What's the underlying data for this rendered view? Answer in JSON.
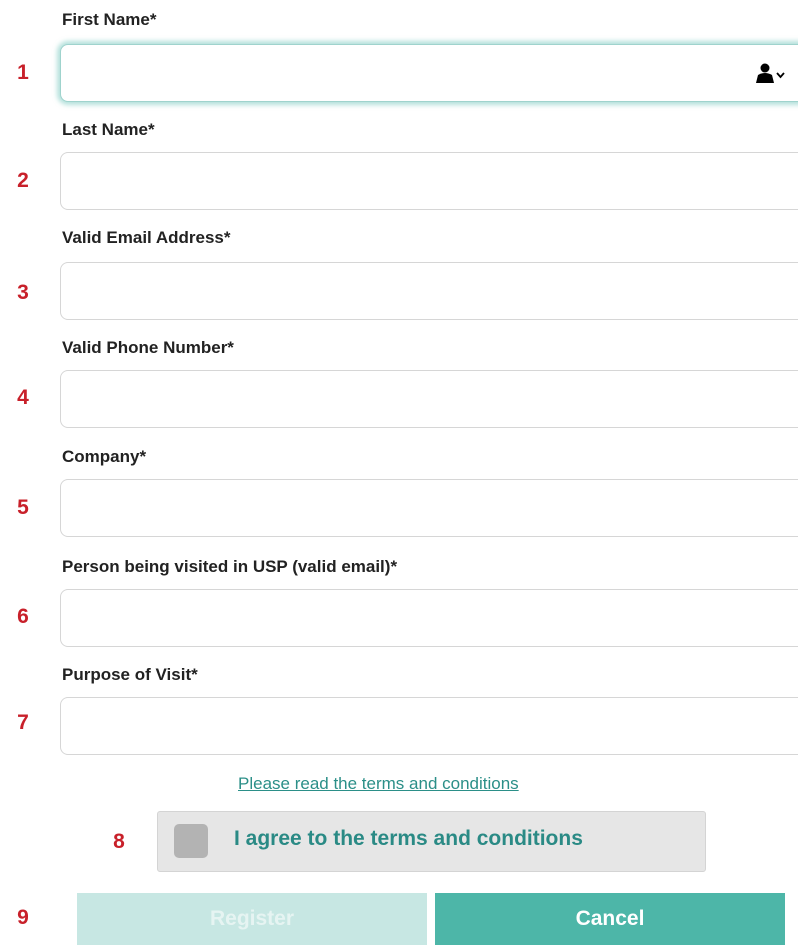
{
  "form": {
    "fields": [
      {
        "num": "1",
        "label": "First Name*",
        "value": ""
      },
      {
        "num": "2",
        "label": "Last Name*",
        "value": ""
      },
      {
        "num": "3",
        "label": "Valid Email Address*",
        "value": ""
      },
      {
        "num": "4",
        "label": "Valid Phone Number*",
        "value": ""
      },
      {
        "num": "5",
        "label": "Company*",
        "value": ""
      },
      {
        "num": "6",
        "label": "Person being visited in USP (valid email)*",
        "value": ""
      },
      {
        "num": "7",
        "label": "Purpose of Visit*",
        "value": ""
      }
    ],
    "autofill_icon": "person-autofill-icon",
    "terms_link": "Please read the terms and conditions",
    "agree": {
      "num": "8",
      "label": "I agree to the terms and conditions",
      "checked": false
    },
    "buttons": {
      "num": "9",
      "register": "Register",
      "cancel": "Cancel"
    }
  },
  "colors": {
    "accent": "#4db6a8",
    "accent_disabled": "#c7e7e3",
    "link": "#2b8f88",
    "annotation_numbers": "#c8202a"
  }
}
